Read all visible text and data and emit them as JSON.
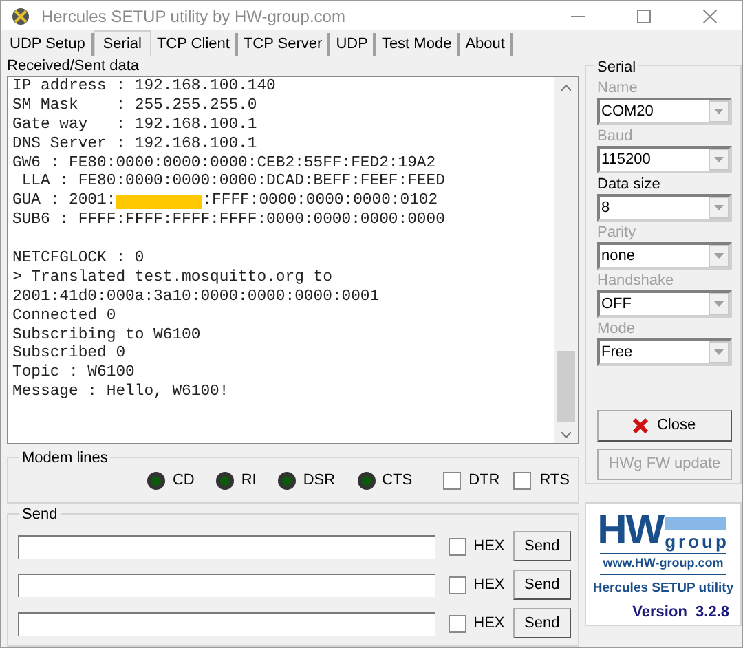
{
  "window": {
    "title": "Hercules SETUP utility by HW-group.com"
  },
  "tabs": [
    {
      "label": "UDP Setup",
      "selected": false
    },
    {
      "label": "Serial",
      "selected": true
    },
    {
      "label": "TCP Client",
      "selected": false
    },
    {
      "label": "TCP Server",
      "selected": false
    },
    {
      "label": "UDP",
      "selected": false
    },
    {
      "label": "Test Mode",
      "selected": false
    },
    {
      "label": "About",
      "selected": false
    }
  ],
  "terminal": {
    "label": "Received/Sent data",
    "lines": [
      {
        "kind": "text",
        "text": "IP address : 192.168.100.140"
      },
      {
        "kind": "text",
        "text": "SM Mask    : 255.255.255.0"
      },
      {
        "kind": "text",
        "text": "Gate way   : 192.168.100.1"
      },
      {
        "kind": "text",
        "text": "DNS Server : 192.168.100.1"
      },
      {
        "kind": "text",
        "text": "GW6 : FE80:0000:0000:0000:CEB2:55FF:FED2:19A2"
      },
      {
        "kind": "text",
        "text": " LLA : FE80:0000:0000:0000:DCAD:BEFF:FEEF:FEED"
      },
      {
        "kind": "redacted",
        "before": "GUA : 2001:",
        "after": ":FFFF:0000:0000:0000:0102"
      },
      {
        "kind": "text",
        "text": "SUB6 : FFFF:FFFF:FFFF:FFFF:0000:0000:0000:0000"
      },
      {
        "kind": "blank"
      },
      {
        "kind": "text",
        "text": "NETCFGLOCK : 0"
      },
      {
        "kind": "text",
        "text": "> Translated test.mosquitto.org to"
      },
      {
        "kind": "text",
        "text": "2001:41d0:000a:3a10:0000:0000:0000:0001"
      },
      {
        "kind": "text",
        "text": "Connected 0"
      },
      {
        "kind": "text",
        "text": "Subscribing to W6100"
      },
      {
        "kind": "text",
        "text": "Subscribed 0"
      },
      {
        "kind": "text",
        "text": "Topic : W6100"
      },
      {
        "kind": "text",
        "text": "Message : Hello, W6100!"
      }
    ]
  },
  "modem_lines": {
    "title": "Modem lines",
    "indicators": [
      {
        "label": "CD",
        "lit": false
      },
      {
        "label": "RI",
        "lit": false
      },
      {
        "label": "DSR",
        "lit": false
      },
      {
        "label": "CTS",
        "lit": false
      }
    ],
    "checkboxes": [
      {
        "label": "DTR",
        "checked": false
      },
      {
        "label": "RTS",
        "checked": false
      }
    ]
  },
  "send": {
    "title": "Send",
    "rows": [
      {
        "hex_label": "HEX",
        "hex": false,
        "button": "Send"
      },
      {
        "hex_label": "HEX",
        "hex": false,
        "button": "Send"
      },
      {
        "hex_label": "HEX",
        "hex": false,
        "button": "Send"
      }
    ]
  },
  "serial": {
    "title": "Serial",
    "fields": [
      {
        "label": "Name",
        "value": "COM20",
        "disabled": true
      },
      {
        "label": "Baud",
        "value": "115200",
        "disabled": true
      },
      {
        "label": "Data size",
        "value": "8",
        "disabled": false
      },
      {
        "label": "Parity",
        "value": "none",
        "disabled": true
      },
      {
        "label": "Handshake",
        "value": "OFF",
        "disabled": true
      },
      {
        "label": "Mode",
        "value": "Free",
        "disabled": true
      }
    ],
    "close_button": "Close",
    "update_button": {
      "label": "HWg FW update",
      "disabled": true
    }
  },
  "logo": {
    "mark": "HW",
    "word": "group",
    "url": "www.HW-group.com",
    "product": "Hercules SETUP utility",
    "version": "Version  3.2.8"
  }
}
